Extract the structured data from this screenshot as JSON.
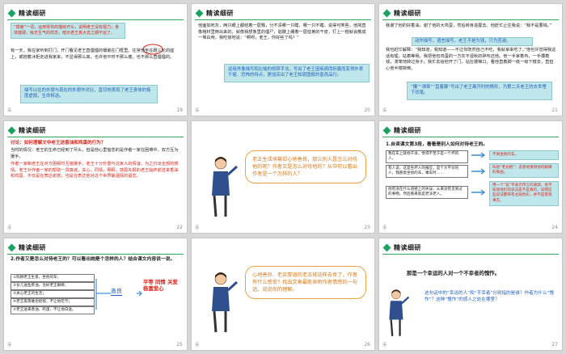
{
  "heading": "精读细研",
  "slide1": {
    "callout": "“摸索”一词，运用零你的描绘开头，说明老王没有视力，身体健硬，吸无生气的样态，暗示老王真大去之期不远了。",
    "para": "有一天，我在家听到打门，开门看见老王直僵僵的镶嵌在门框里。往常他坐在蹬三轮的座上，或抱着冰柜走进我家来，不显得那么高。也许他平时不那么瘦，也不那么直僵僵的。",
    "note": "描写以往的外貌与现在的外貌作对比，直切地表现了老王身体的极度虚弱，生命将逝。",
    "num": "19"
  },
  "slide2": {
    "para": "他面如死灰，两只眼上都结着一层翳，分不清哪一只瞎、哪一只不瞎。说得可笑些，他简直像棺材里倒出来的，就像我想象里的僵尸，骷髅上绷着一层枯黄的干皮，打上一棍就会散成一堆白骨。我吃惊地说：“啊呀，老王，你好些了吗？”",
    "note": "运用肖像描写和比喻的修辞手法，写出了老王因疾病而折磨而变得外表干瘦、恐怖的特点，更加突出了老王知恩图报的善良品行。",
    "num": "20"
  },
  "slide3": {
    "para1": "我谢了他的好香油，谢了他的大鸡蛋，然后转身进屋去。他赶忙止住我说：“我不是要钱。”",
    "note1": "动作描写，语言描写，老王不是为钱，只为答谢。",
    "para2": "我也赶忙解释：“我知道，我知道——不过你既然自己不吃，我就拿来吃了。”他也许觉得我这话有理，站着等我。我把他包鸡蛋的一方灰不溜秋的碎布还他。他一手拿着布，一手攥着钱，滞笨地转过身子。我忙去给他开了门，站在楼梯口，看他直着脚一级一级下楼去，直担心他半楼摔倒。",
    "note2": "“攥”“滞笨”“直着脚”写出了老王离开时的情形，为第二天老王的去世埋下伏笔。",
    "num": "21"
  },
  "slide4": {
    "q": "讨论：如何理解文中老王送香油和鸡蛋的行为？",
    "s1": "当时的情况：老王的生命已经到了尽头，但是他心里惦念的是作者一家在困难中，双方互为援手。",
    "s2": "作者一家和老王在对方困顿时互施援手，老王十分珍重与这家人的情谊，为之付出全部的感情。老王对作者一家的帮助一贯真诚，关心，同情，照顾，感恩先报的老王临终前送来香油和鸡蛋，不仅是在表达谢意，也是在表达他对这个世界最温情的留恋。",
    "num": "22"
  },
  "slide5": {
    "bubble": "老王生活境幕却心地善良，那么别人是怎么对待他的呢？作者又是怎么对待他的？从中可以看出作者是一个怎样的人？",
    "num": "23"
  },
  "slide6": {
    "title": "1.自读课文第3段，看看是别人如何对待老王的。",
    "b1": "我在车上就他干净，觉得不至于是一个坏的人。",
    "b2": "有人说，这是生坏人的报应，是个大不对的人，我愿意坐他的车，乘车时……",
    "b3": "他有没在什么道德上的失误，从来没有见到过的事物，然后看来就是老派老人。",
    "c1": "不屑坐他的车。",
    "c2": "叫他“老光棍”：恶意地猜测他的眼睛的来由。",
    "c3": "用一个“说”字表示传言的来源，他不知道他们的说法是不是真的，说明这些说法都带有主观色彩，并不是客观事实。",
    "num": "24"
  },
  "slide7": {
    "title": "2.作者又是怎么对待老王的？可以看出她是个怎样的人？结合课文内容说一说。",
    "i1": "①照顾老王生意，坐他的车；",
    "i2": "②女儿送鱼肝油，治好老王眼睛；",
    "i3": "③关心老王的生活；",
    "i4": "④老王再落难也给钱，不让他吃亏；",
    "i5": "⑤老王送来香油、鸡蛋，不让他白送。",
    "k1": "善良",
    "k2": "平等 同情 关爱 极富爱心",
    "num": "25"
  },
  "slide8": {
    "bubble": "心地善良、老实厚道的老王就这样去世了，作者有什么感受？找出文章最能表明作者情感的一句话，说说你的理解。",
    "num": "26"
  },
  "slide9": {
    "line1": "那是一个幸运的人对一个不幸者的愧怍。",
    "q": "这句话中的“幸运的人”和“不幸者”分别指的是谁？作者为什么“愧怍”？这种“愧怍”的感人之处在哪里？",
    "num": "27"
  },
  "colors": {
    "accent": "#1aa260",
    "red": "#d9261c",
    "blue": "#1f5fbf",
    "orange": "#f0a040"
  }
}
